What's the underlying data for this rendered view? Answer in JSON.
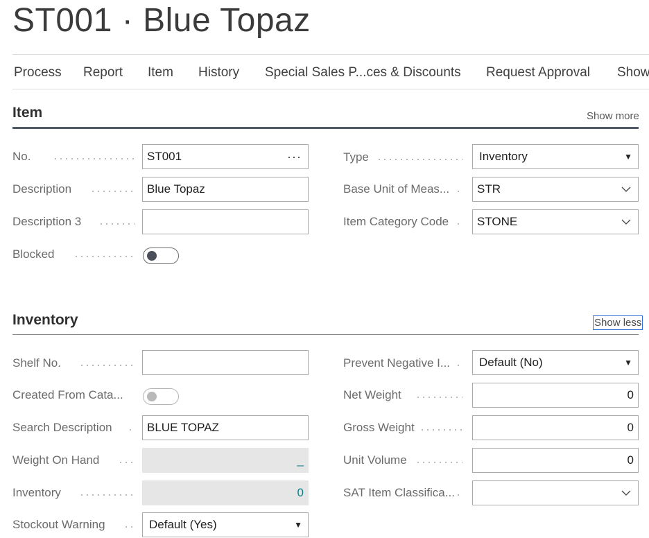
{
  "page": {
    "title": "ST001 · Blue Topaz"
  },
  "actions": [
    "Process",
    "Report",
    "Item",
    "History",
    "Special Sales P...ces & Discounts",
    "Request Approval",
    "Show"
  ],
  "item_section": {
    "title": "Item",
    "show_link": "Show more",
    "no": {
      "label": "No.",
      "value": "ST001"
    },
    "description": {
      "label": "Description",
      "value": "Blue Topaz"
    },
    "description3": {
      "label": "Description 3",
      "value": ""
    },
    "blocked": {
      "label": "Blocked",
      "on": false
    },
    "type": {
      "label": "Type",
      "value": "Inventory"
    },
    "base_unit": {
      "label": "Base Unit of Meas...",
      "value": "STR"
    },
    "item_category": {
      "label": "Item Category Code",
      "value": "STONE"
    }
  },
  "inventory_section": {
    "title": "Inventory",
    "show_link": "Show less",
    "shelf_no": {
      "label": "Shelf No.",
      "value": ""
    },
    "created_from_catalog": {
      "label": "Created From Cata...",
      "on": false
    },
    "search_description": {
      "label": "Search Description",
      "value": "BLUE TOPAZ"
    },
    "weight_on_hand": {
      "label": "Weight On Hand",
      "value": "_"
    },
    "inventory": {
      "label": "Inventory",
      "value": "0"
    },
    "stockout_warning": {
      "label": "Stockout Warning",
      "value": "Default (Yes)"
    },
    "prevent_negative": {
      "label": "Prevent Negative I...",
      "value": "Default (No)"
    },
    "net_weight": {
      "label": "Net Weight",
      "value": "0"
    },
    "gross_weight": {
      "label": "Gross Weight",
      "value": "0"
    },
    "unit_volume": {
      "label": "Unit Volume",
      "value": "0"
    },
    "sat_item": {
      "label": "SAT Item Classifica...",
      "value": ""
    }
  },
  "colors": {
    "accent_link": "#0a7c86",
    "focus_border": "#2f6fd6",
    "section_rule": "#505a66"
  }
}
